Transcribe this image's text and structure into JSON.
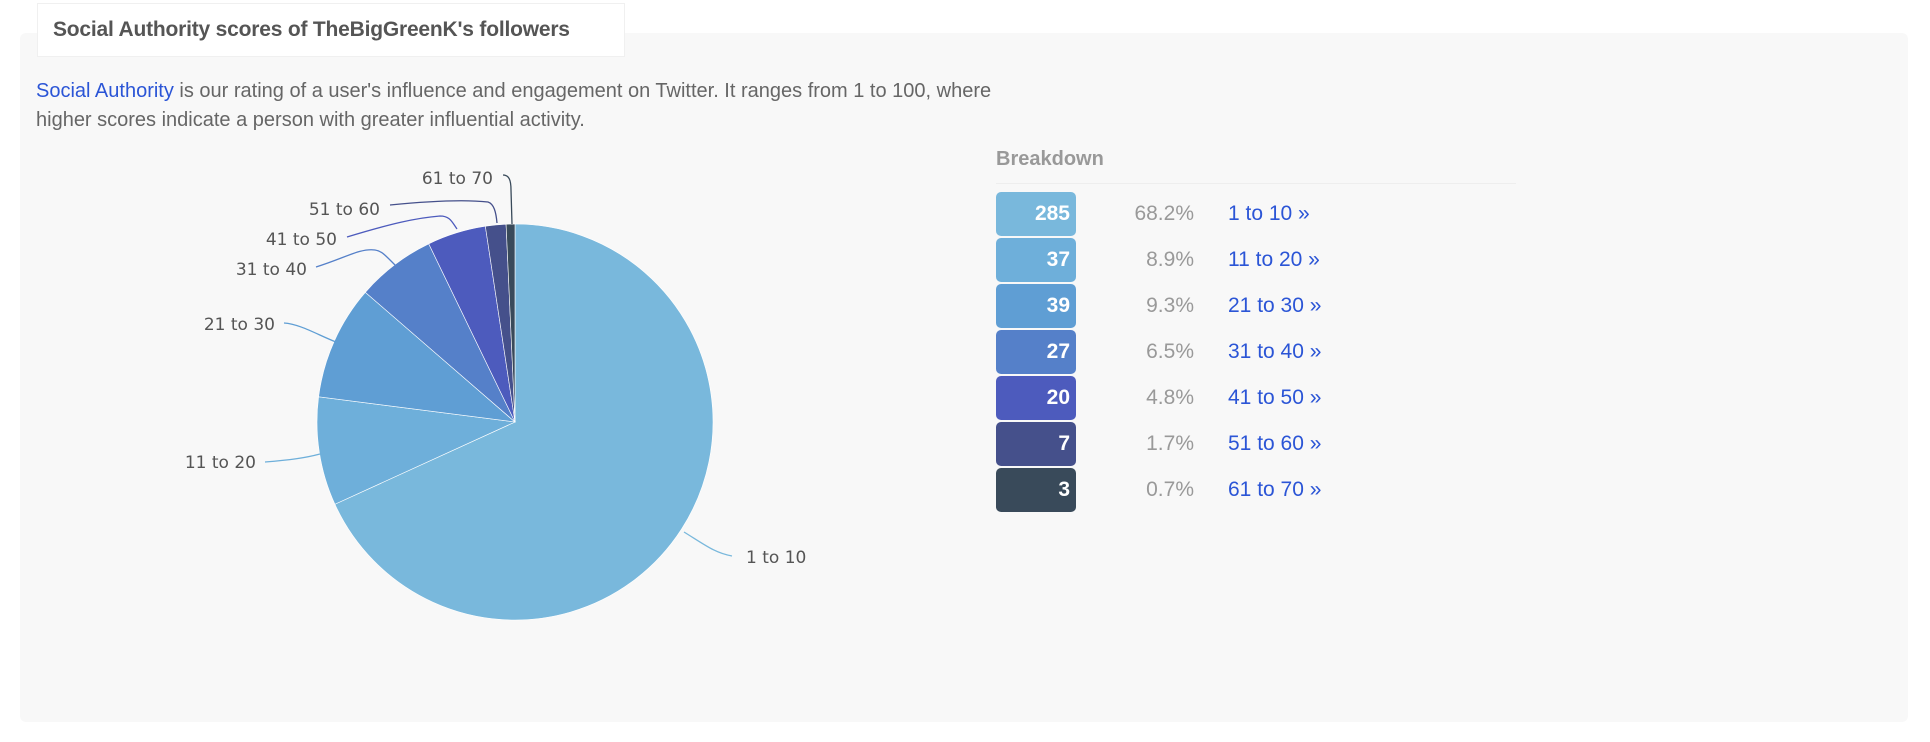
{
  "header": {
    "title": "Social Authority scores of TheBigGreenK's followers"
  },
  "description": {
    "link_text": "Social Authority",
    "text": " is our rating of a user's influence and engagement on Twitter. It ranges from 1 to 100, where higher scores indicate a person with greater influential activity."
  },
  "breakdown": {
    "title": "Breakdown",
    "rows": [
      {
        "count": "285",
        "percent": "68.2%",
        "link": "1 to 10 »",
        "color": "#79b8dc"
      },
      {
        "count": "37",
        "percent": "8.9%",
        "link": "11 to 20 »",
        "color": "#6eafda"
      },
      {
        "count": "39",
        "percent": "9.3%",
        "link": "21 to 30 »",
        "color": "#5f9ed4"
      },
      {
        "count": "27",
        "percent": "6.5%",
        "link": "31 to 40 »",
        "color": "#5580c9"
      },
      {
        "count": "20",
        "percent": "4.8%",
        "link": "41 to 50 »",
        "color": "#4d5bbd"
      },
      {
        "count": "7",
        "percent": "1.7%",
        "link": "51 to 60 »",
        "color": "#45508b"
      },
      {
        "count": "3",
        "percent": "0.7%",
        "link": "61 to 70 »",
        "color": "#394a5a"
      }
    ]
  },
  "chart_data": {
    "type": "pie",
    "title": "Social Authority scores of TheBigGreenK's followers",
    "categories": [
      "1 to 10",
      "11 to 20",
      "21 to 30",
      "31 to 40",
      "41 to 50",
      "51 to 60",
      "61 to 70"
    ],
    "values": [
      285,
      37,
      39,
      27,
      20,
      7,
      3
    ],
    "percentages": [
      68.2,
      8.9,
      9.3,
      6.5,
      4.8,
      1.7,
      0.7
    ],
    "colors": [
      "#79b8dc",
      "#6eafda",
      "#5f9ed4",
      "#5580c9",
      "#4d5bbd",
      "#45508b",
      "#394a5a"
    ],
    "start": "12 o'clock",
    "direction": "clockwise",
    "legend": "none"
  }
}
